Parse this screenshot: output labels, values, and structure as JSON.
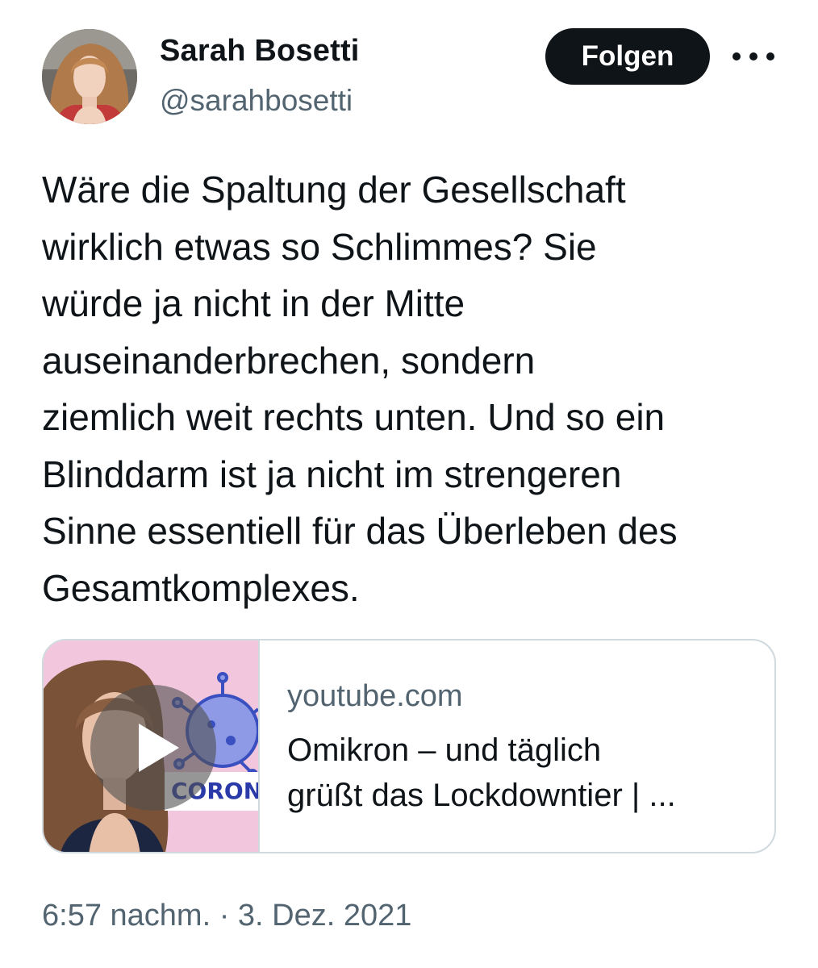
{
  "author": {
    "display_name": "Sarah Bosetti",
    "handle": "@sarahbosetti"
  },
  "actions": {
    "follow_label": "Folgen",
    "more_icon": "more-horizontal-icon"
  },
  "tweet": {
    "text_lines": [
      "Wäre die Spaltung der Gesellschaft",
      "wirklich etwas so Schlimmes? Sie",
      "würde ja nicht in der Mitte",
      "auseinanderbrechen, sondern",
      "ziemlich weit rechts unten. Und so ein",
      "Blinddarm ist ja nicht im strengeren",
      "Sinne essentiell für das Überleben des",
      "Gesamtkomplexes."
    ]
  },
  "link_card": {
    "domain": "youtube.com",
    "title_lines": [
      "Omikron – und täglich",
      "grüßt das Lockdowntier | ..."
    ],
    "thumbnail_label": "CORONA",
    "play_icon": "play-icon"
  },
  "footer": {
    "timestamp": "6:57 nachm. · 3. Dez. 2021"
  },
  "colors": {
    "text": "#0f1419",
    "secondary": "#536471",
    "border": "#cfd9de",
    "button_bg": "#0f1419",
    "thumbnail_bg": "#f2c6dc",
    "virus": "#3a4fc0"
  }
}
